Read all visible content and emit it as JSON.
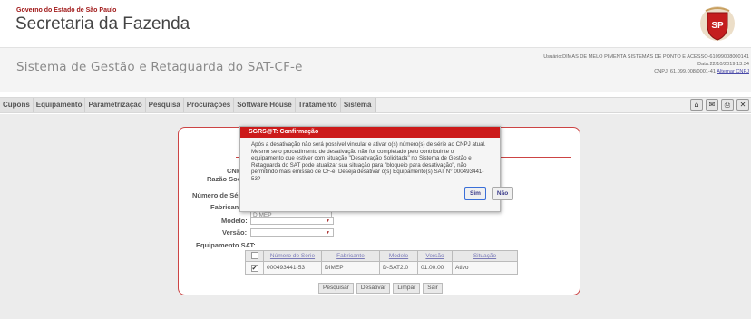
{
  "header": {
    "gov_line": "Governo do Estado de São Paulo",
    "secretaria": "Secretaria da Fazenda",
    "emblem_icon": "sp-coat-of-arms-icon"
  },
  "system": {
    "title": "Sistema de Gestão e Retaguarda do SAT-CF-e",
    "user_line": "Usuário:DIMAS DE MELO PIMENTA SISTEMAS DE PONTO E ACESSO-61099008000141",
    "date_line": "Data:22/10/2019 13:34",
    "cnpj_line": "CNPJ: 61.099.008/0001-41",
    "change_link": "Alternar CNPJ"
  },
  "menu": {
    "items": [
      "Cupons",
      "Equipamento",
      "Parametrização",
      "Pesquisa",
      "Procurações",
      "Software House",
      "Tratamento",
      "Sistema"
    ],
    "icons": [
      "home-icon",
      "mail-icon",
      "print-icon",
      "close-icon"
    ]
  },
  "form": {
    "cnpj_label": "CNP",
    "razao_label": "Razão Socia",
    "numero_serie_label": "Número de Séri",
    "fabricante_label": "Fabricant",
    "fabricante_value": "DIMEP",
    "modelo_label": "Modelo:",
    "versao_label": "Versão:",
    "equip_label": "Equipamento SAT:"
  },
  "table": {
    "headers": [
      "Número de Série",
      "Fabricante",
      "Modelo",
      "Versão",
      "Situação"
    ],
    "rows": [
      {
        "checked": true,
        "serie": "000493441-53",
        "fabricante": "DIMEP",
        "modelo": "D-SAT2.0",
        "versao": "01.00.00",
        "situacao": "Ativo"
      }
    ]
  },
  "actions": {
    "pesquisar": "Pesquisar",
    "desativar": "Desativar",
    "limpar": "Limpar",
    "sair": "Sair"
  },
  "dialog": {
    "title": "SGRS@T: Confirmação",
    "message": "Após a desativação não será possível vincular e ativar o(s) número(s) de série ao CNPJ atual. Mesmo se o procedimento de desativação não for completado pelo contribuinte o equipamento que estiver com situação \"Desativação Solicitada\" no Sistema de Gestão e Retaguarda do SAT pode atualizar sua situação para \"bloqueio para desativação\", não permitindo mais emissão de CF-e. Deseja desativar o(s) Equipamento(s) SAT N° 000493441-53?",
    "yes": "Sim",
    "no": "Não"
  },
  "colors": {
    "accent_red": "#cc1a1a",
    "panel_border": "#cc4444",
    "link": "#4a4aa8"
  }
}
